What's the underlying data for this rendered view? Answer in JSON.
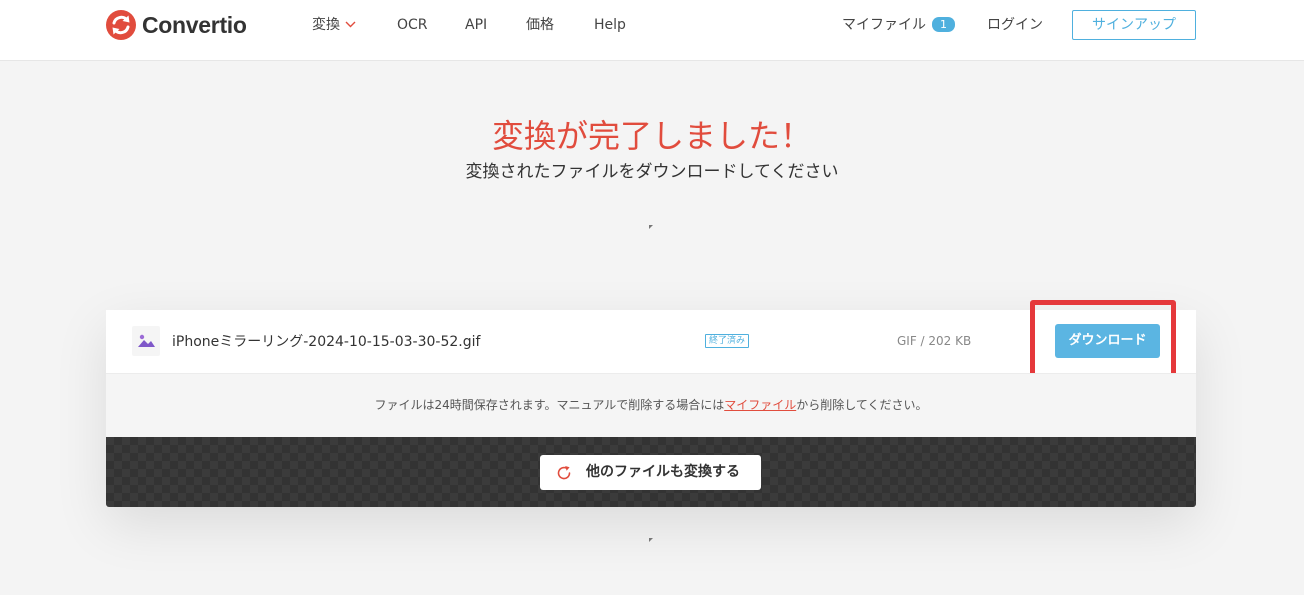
{
  "header": {
    "logo_text": "Convertio",
    "nav": [
      {
        "label": "変換",
        "has_dropdown": true
      },
      {
        "label": "OCR"
      },
      {
        "label": "API"
      },
      {
        "label": "価格"
      },
      {
        "label": "Help"
      }
    ],
    "my_files": {
      "label": "マイファイル",
      "count": "1"
    },
    "login": "ログイン",
    "signup": "サインアップ"
  },
  "hero": {
    "title": "変換が完了しました！",
    "subtitle": "変換されたファイルをダウンロードしてください"
  },
  "file": {
    "name": "iPhoneミラーリング-2024-10-15-03-30-52.gif",
    "status": "終了済み",
    "meta": "GIF / 202 KB",
    "download_label": "ダウンロード"
  },
  "note": {
    "before": "ファイルは24時間保存されます。マニュアルで削除する場合には",
    "link": "マイファイル",
    "after": "から削除してください。"
  },
  "convert_more": {
    "label": "他のファイルも変換する"
  },
  "colors": {
    "brand_red": "#e14c3d",
    "accent_blue": "#4fb0de",
    "highlight": "#e5383b"
  },
  "icons": [
    "convertio-logo-icon",
    "chevron-down-icon",
    "image-file-icon",
    "refresh-icon"
  ]
}
